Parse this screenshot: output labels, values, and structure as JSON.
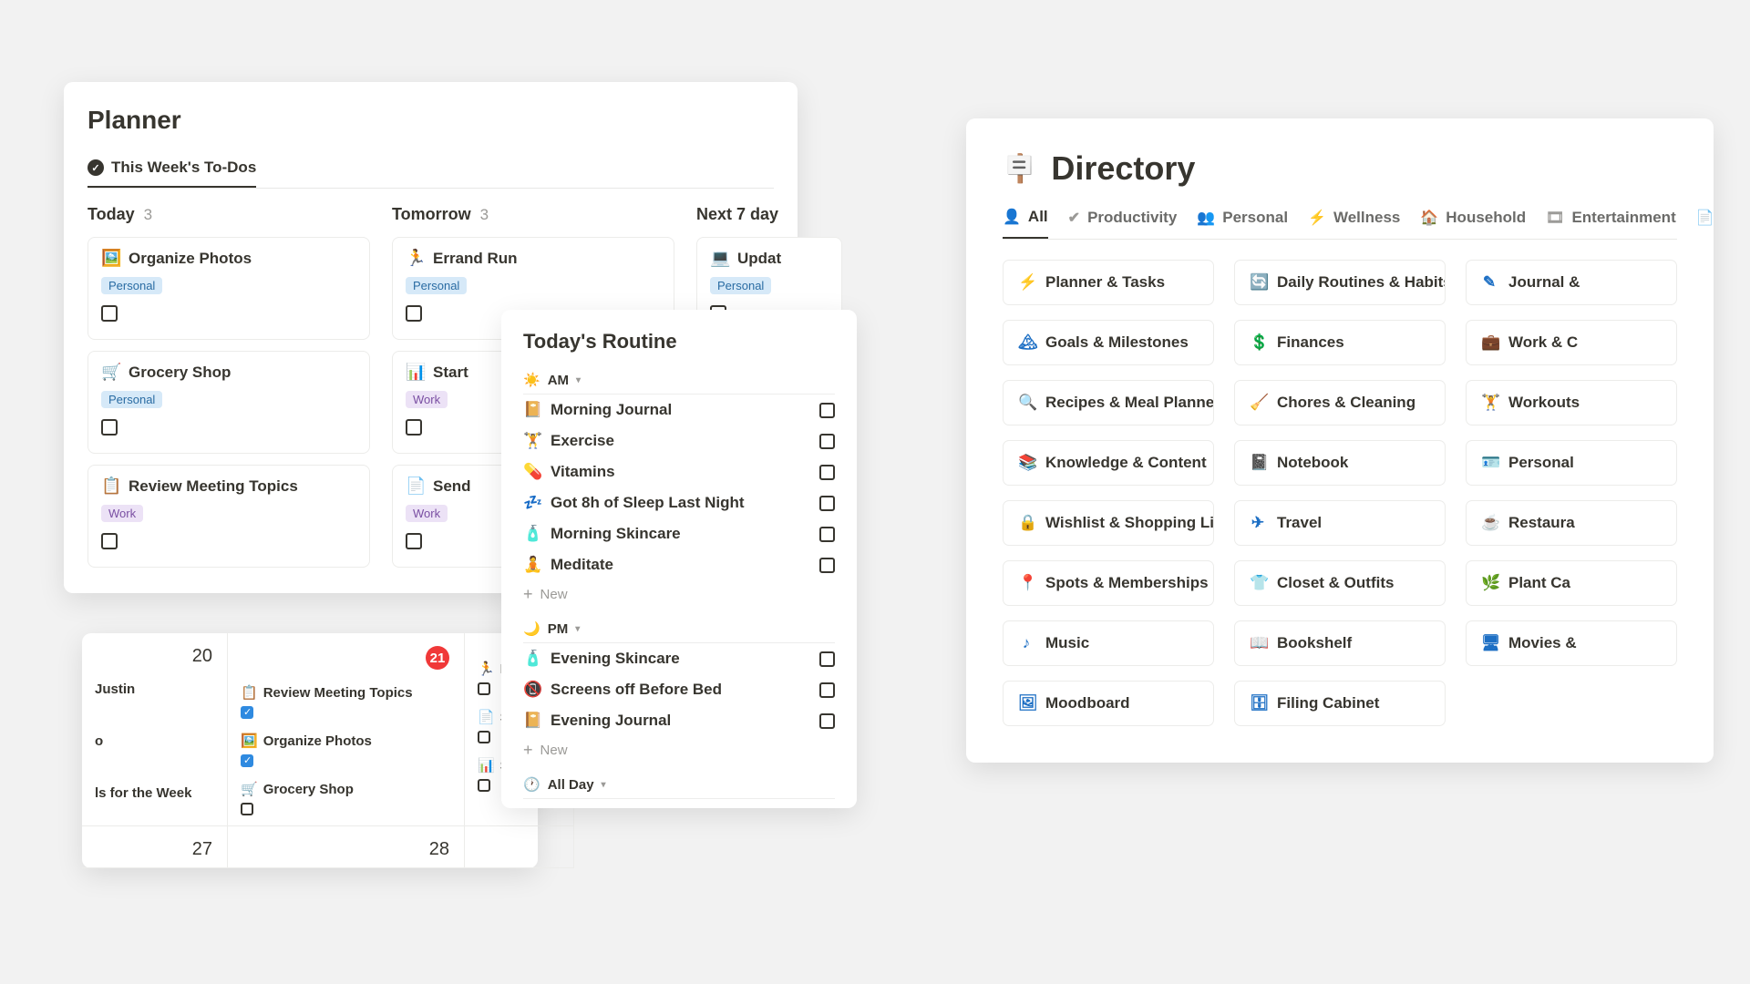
{
  "planner": {
    "title": "Planner",
    "tab": "This Week's To-Dos",
    "columns": [
      {
        "name": "Today",
        "count": "3",
        "cards": [
          {
            "emoji": "🖼️",
            "title": "Organize Photos",
            "tag": "Personal"
          },
          {
            "emoji": "🛒",
            "title": "Grocery Shop",
            "tag": "Personal"
          },
          {
            "emoji": "📋",
            "title": "Review Meeting Topics",
            "tag": "Work"
          }
        ]
      },
      {
        "name": "Tomorrow",
        "count": "3",
        "cards": [
          {
            "emoji": "🏃",
            "title": "Errand Run",
            "tag": "Personal"
          },
          {
            "emoji": "📊",
            "title": "Start",
            "tag": "Work"
          },
          {
            "emoji": "📄",
            "title": "Send",
            "tag": "Work"
          }
        ]
      },
      {
        "name": "Next 7 day",
        "count": "",
        "cards": [
          {
            "emoji": "💻",
            "title": "Updat",
            "tag": "Personal"
          }
        ]
      }
    ]
  },
  "calendar": {
    "r1": {
      "c1": {
        "day": "20",
        "items": [
          {
            "emoji": "",
            "text": "Justin",
            "done": false,
            "nochk": true
          }
        ]
      },
      "c2": {
        "day": "21",
        "badge": true,
        "items": [
          {
            "emoji": "📋",
            "text": "Review Meeting Topics",
            "done": true
          },
          {
            "emoji": "🖼️",
            "text": "Organize Photos",
            "done": true
          },
          {
            "emoji": "🛒",
            "text": "Grocery Shop",
            "done": false
          }
        ]
      },
      "c3": {
        "day": "",
        "items": [
          {
            "emoji": "🏃",
            "text": "Erra",
            "done": false
          },
          {
            "emoji": "📄",
            "text": "Ser",
            "done": false,
            "nochk": false
          },
          {
            "emoji": "📊",
            "text": "Sta",
            "done": false
          }
        ]
      }
    },
    "r1_extra_c1": [
      {
        "emoji": "",
        "text": "o",
        "nochk": true
      },
      {
        "emoji": "",
        "text": "ls for the Week",
        "nochk": true
      }
    ],
    "r2": {
      "c1_day": "27",
      "c2_day": "28"
    }
  },
  "routine": {
    "title": "Today's Routine",
    "sections": [
      {
        "icon": "☀️",
        "label": "AM",
        "items": [
          {
            "emoji": "📔",
            "text": "Morning Journal"
          },
          {
            "emoji": "🏋️",
            "text": "Exercise"
          },
          {
            "emoji": "💊",
            "text": "Vitamins"
          },
          {
            "emoji": "💤",
            "text": "Got 8h of Sleep Last Night"
          },
          {
            "emoji": "🧴",
            "text": "Morning Skincare"
          },
          {
            "emoji": "🧘",
            "text": "Meditate"
          }
        ],
        "new": "New"
      },
      {
        "icon": "🌙",
        "label": "PM",
        "items": [
          {
            "emoji": "🧴",
            "text": "Evening Skincare"
          },
          {
            "emoji": "📵",
            "text": "Screens off Before Bed"
          },
          {
            "emoji": "📔",
            "text": "Evening Journal"
          }
        ],
        "new": "New"
      },
      {
        "icon": "🕐",
        "label": "All Day",
        "items": [],
        "new": ""
      }
    ]
  },
  "directory": {
    "title": "Directory",
    "tabs": [
      {
        "icon": "👤",
        "label": "All",
        "active": true
      },
      {
        "icon": "✔",
        "label": "Productivity"
      },
      {
        "icon": "👥",
        "label": "Personal"
      },
      {
        "icon": "⚡",
        "label": "Wellness"
      },
      {
        "icon": "🏠",
        "label": "Household"
      },
      {
        "icon": "🎞",
        "label": "Entertainment"
      },
      {
        "icon": "📄",
        "label": ""
      }
    ],
    "items": [
      {
        "icon": "⚡",
        "label": "Planner & Tasks"
      },
      {
        "icon": "🔄",
        "label": "Daily Routines & Habits"
      },
      {
        "icon": "✎",
        "label": "Journal &"
      },
      {
        "icon": "🏔",
        "label": "Goals & Milestones"
      },
      {
        "icon": "💲",
        "label": "Finances"
      },
      {
        "icon": "💼",
        "label": "Work & C"
      },
      {
        "icon": "🔍",
        "label": "Recipes & Meal Planner"
      },
      {
        "icon": "🧹",
        "label": "Chores & Cleaning"
      },
      {
        "icon": "🏋",
        "label": "Workouts"
      },
      {
        "icon": "📚",
        "label": "Knowledge & Content"
      },
      {
        "icon": "📓",
        "label": "Notebook"
      },
      {
        "icon": "🪪",
        "label": "Personal"
      },
      {
        "icon": "🔒",
        "label": "Wishlist & Shopping List"
      },
      {
        "icon": "✈",
        "label": "Travel"
      },
      {
        "icon": "☕",
        "label": "Restaura"
      },
      {
        "icon": "📍",
        "label": "Spots & Memberships"
      },
      {
        "icon": "👕",
        "label": "Closet & Outfits"
      },
      {
        "icon": "🌿",
        "label": "Plant Ca"
      },
      {
        "icon": "♪",
        "label": "Music"
      },
      {
        "icon": "📖",
        "label": "Bookshelf"
      },
      {
        "icon": "🖥",
        "label": "Movies &"
      },
      {
        "icon": "🖼",
        "label": "Moodboard"
      },
      {
        "icon": "🗄",
        "label": "Filing Cabinet"
      }
    ]
  }
}
